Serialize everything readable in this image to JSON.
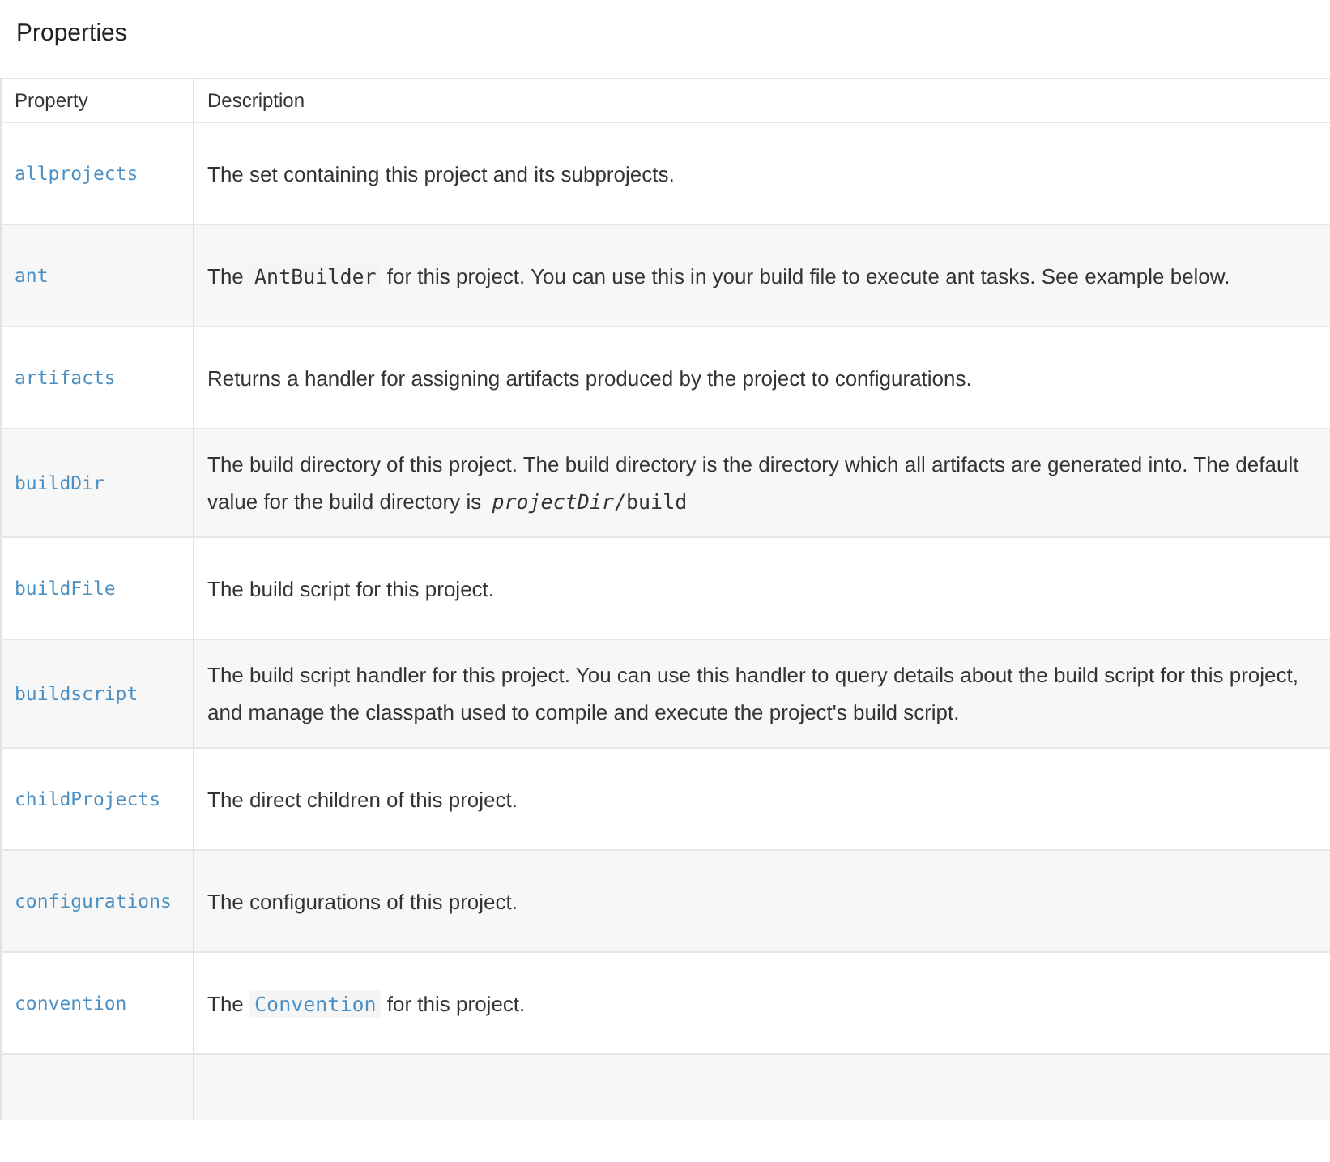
{
  "title": "Properties",
  "table": {
    "columns": [
      "Property",
      "Description"
    ],
    "rows": [
      {
        "property": "allprojects",
        "description": [
          {
            "kind": "text",
            "text": "The set containing this project and its subprojects."
          }
        ]
      },
      {
        "property": "ant",
        "description": [
          {
            "kind": "text",
            "text": "The "
          },
          {
            "kind": "code",
            "text": "AntBuilder"
          },
          {
            "kind": "text",
            "text": " for this project. You can use this in your build file to execute ant tasks. See example below."
          }
        ]
      },
      {
        "property": "artifacts",
        "description": [
          {
            "kind": "text",
            "text": "Returns a handler for assigning artifacts produced by the project to configurations."
          }
        ]
      },
      {
        "property": "buildDir",
        "description": [
          {
            "kind": "text",
            "text": "The build directory of this project. The build directory is the directory which all artifacts are generated into. The default value for the build directory is "
          },
          {
            "kind": "code-italic",
            "text": "projectDir"
          },
          {
            "kind": "code-plain",
            "text": "/build"
          }
        ]
      },
      {
        "property": "buildFile",
        "description": [
          {
            "kind": "text",
            "text": "The build script for this project."
          }
        ]
      },
      {
        "property": "buildscript",
        "description": [
          {
            "kind": "text",
            "text": "The build script handler for this project. You can use this handler to query details about the build script for this project, and manage the classpath used to compile and execute the project's build script."
          }
        ]
      },
      {
        "property": "childProjects",
        "description": [
          {
            "kind": "text",
            "text": "The direct children of this project."
          }
        ]
      },
      {
        "property": "configurations",
        "description": [
          {
            "kind": "text",
            "text": "The configurations of this project."
          }
        ]
      },
      {
        "property": "convention",
        "description": [
          {
            "kind": "text",
            "text": "The "
          },
          {
            "kind": "code-link",
            "text": "Convention"
          },
          {
            "kind": "text",
            "text": " for this project."
          }
        ]
      }
    ]
  }
}
